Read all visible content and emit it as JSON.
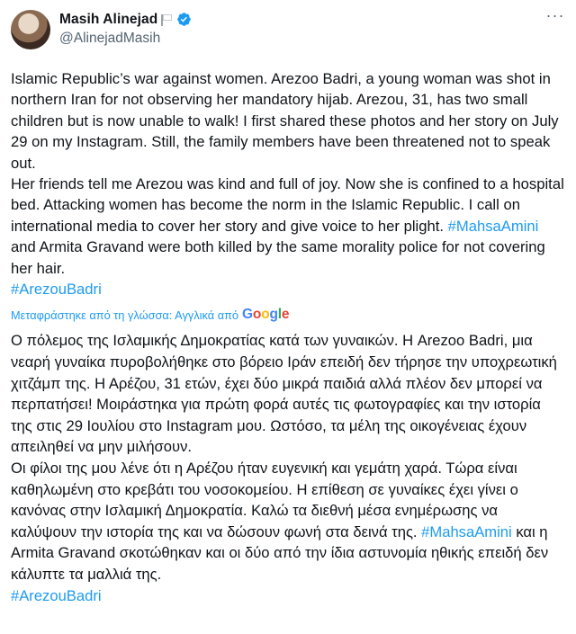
{
  "author": {
    "display_name": "Masih Alinejad",
    "handle": "@AlinejadMasih"
  },
  "more_options": "···",
  "original": {
    "para1": "Islamic Republic’s war against women. Arezoo Badri, a young woman was shot in northern Iran for not observing her mandatory hijab. Arezou, 31, has two small children but is now unable to walk! I first shared these photos and her story on July 29 on my Instagram. Still, the family members have been threatened not to speak out.",
    "para2_before": "Her friends tell me Arezou was kind and full of joy. Now she is confined to a hospital bed. Attacking women has become the norm in the Islamic Republic. I call on international media to cover her story and give voice to her plight. ",
    "hashtag1": "#MahsaAmini",
    "para2_after": " and Armita Gravand were both killed by the same morality police for not covering her hair.",
    "hashtag2": "#ArezouBadri"
  },
  "translation_note": "Μεταφράστηκε από τη γλώσσα: Αγγλικά από",
  "google": {
    "G": "G",
    "o1": "o",
    "o2": "o",
    "g": "g",
    "l": "l",
    "e": "e"
  },
  "translated": {
    "para1": "Ο πόλεμος της Ισλαμικής Δημοκρατίας κατά των γυναικών. Η Arezoo Badri, μια νεαρή γυναίκα πυροβολήθηκε στο βόρειο Ιράν επειδή δεν τήρησε την υποχρεωτική χιτζάμπ της. Η Αρέζου, 31 ετών, έχει δύο μικρά παιδιά αλλά πλέον δεν μπορεί να περπατήσει! Μοιράστηκα για πρώτη φορά αυτές τις φωτογραφίες και την ιστορία της στις 29 Ιουλίου στο Instagram μου. Ωστόσο, τα μέλη της οικογένειας έχουν απειληθεί να μην μιλήσουν.",
    "para2_before": "Οι φίλοι της μου λένε ότι η Αρέζου ήταν ευγενική και γεμάτη χαρά. Τώρα είναι καθηλωμένη στο κρεβάτι του νοσοκομείου. Η επίθεση σε γυναίκες έχει γίνει ο κανόνας στην Ισλαμική Δημοκρατία. Καλώ τα διεθνή μέσα ενημέρωσης να καλύψουν την ιστορία της και να δώσουν φωνή στα δεινά της. ",
    "hashtag1": "#MahsaAmini",
    "para2_after": " και η Armita Gravand σκοτώθηκαν και οι δύο από την ίδια αστυνομία ηθικής επειδή δεν κάλυπτε τα μαλλιά της.",
    "hashtag2": "#ArezouBadri"
  },
  "colors": {
    "link": "#1d9bf0",
    "text": "#0f1419",
    "secondary": "#536471",
    "verified": "#1d9bf0"
  },
  "icons": {
    "verified": "verified-badge-icon",
    "flag": "white-flag-icon",
    "more": "more-options-icon"
  }
}
